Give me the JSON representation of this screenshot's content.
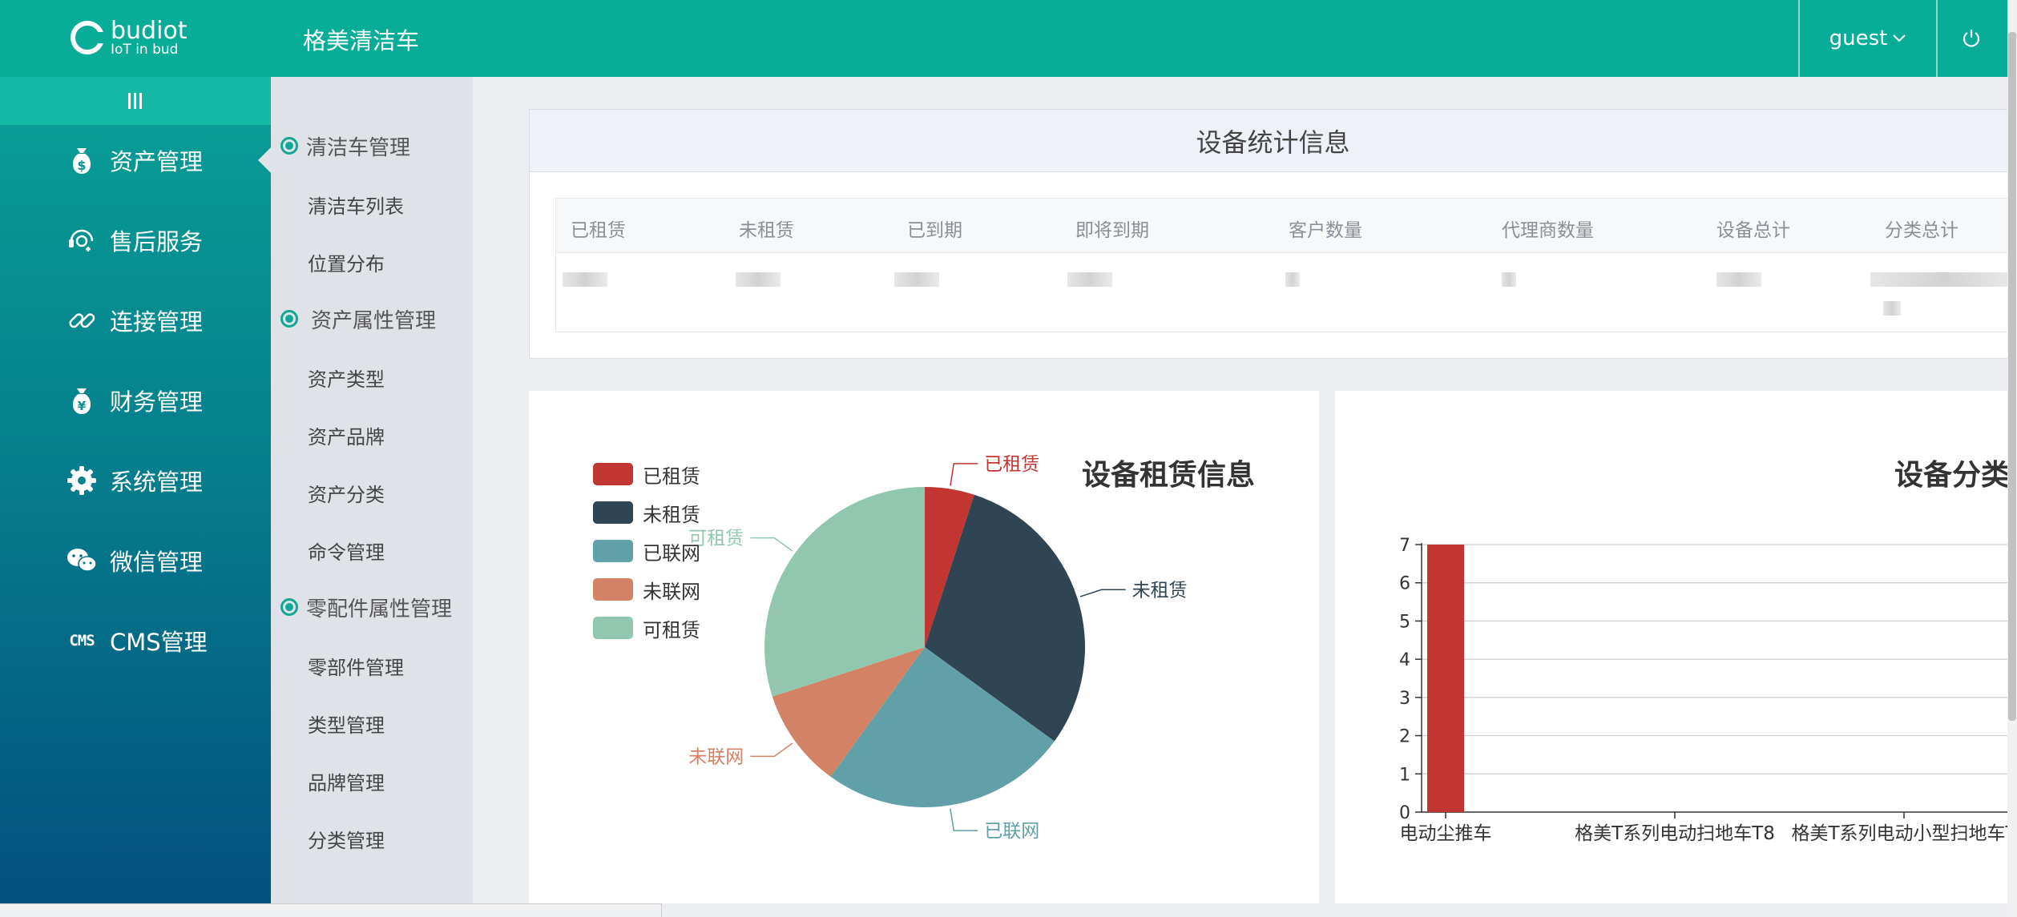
{
  "brand": {
    "name": "budiot",
    "tagline": "IoT in bud"
  },
  "app_title": "格美清洁车",
  "user": {
    "name": "guest"
  },
  "nav": [
    {
      "label": "资产管理",
      "icon": "money-bag-icon",
      "active": true
    },
    {
      "label": "售后服务",
      "icon": "support-icon",
      "active": false
    },
    {
      "label": "连接管理",
      "icon": "link-icon",
      "active": false
    },
    {
      "label": "财务管理",
      "icon": "yuan-bag-icon",
      "active": false
    },
    {
      "label": "系统管理",
      "icon": "gear-icon",
      "active": false
    },
    {
      "label": "微信管理",
      "icon": "wechat-icon",
      "active": false
    },
    {
      "label": "CMS管理",
      "icon": "cms-icon",
      "icon_text": "CMS",
      "active": false
    }
  ],
  "submenu": {
    "groups": [
      {
        "label": "清洁车管理",
        "items": [
          "清洁车列表",
          "位置分布"
        ]
      },
      {
        "label": "资产属性管理",
        "items": [
          "资产类型",
          "资产品牌",
          "资产分类",
          "命令管理"
        ]
      },
      {
        "label": "零配件属性管理",
        "items": [
          "零部件管理",
          "类型管理",
          "品牌管理",
          "分类管理"
        ]
      }
    ]
  },
  "stats": {
    "title": "设备统计信息",
    "columns": [
      "已租赁",
      "未租赁",
      "已到期",
      "即将到期",
      "客户数量",
      "代理商数量",
      "设备总计",
      "分类总计"
    ]
  },
  "pie_panel": {
    "title": "设备租赁信息"
  },
  "bar_panel": {
    "title": "设备分类"
  },
  "chart_data": [
    {
      "type": "pie",
      "title": "设备租赁信息",
      "legend": [
        "已租赁",
        "未租赁",
        "已联网",
        "未联网",
        "可租赁"
      ],
      "legend_position": "top-left",
      "slices": [
        {
          "name": "已租赁",
          "value": 5,
          "color": "#c23531"
        },
        {
          "name": "未租赁",
          "value": 30,
          "color": "#2f4554"
        },
        {
          "name": "已联网",
          "value": 25,
          "color": "#61a0a8"
        },
        {
          "name": "未联网",
          "value": 10,
          "color": "#d48265"
        },
        {
          "name": "可租赁",
          "value": 30,
          "color": "#91c7ae"
        }
      ]
    },
    {
      "type": "bar",
      "title": "设备分类",
      "categories": [
        "电动尘推车",
        "格美T系列电动扫地车T8",
        "格美T系列电动小型扫地车T"
      ],
      "values": [
        7,
        0,
        0
      ],
      "ylim": [
        0,
        7
      ],
      "yticks": [
        0,
        1,
        2,
        3,
        4,
        5,
        6,
        7
      ],
      "grid": true,
      "color": "#c23531"
    }
  ]
}
